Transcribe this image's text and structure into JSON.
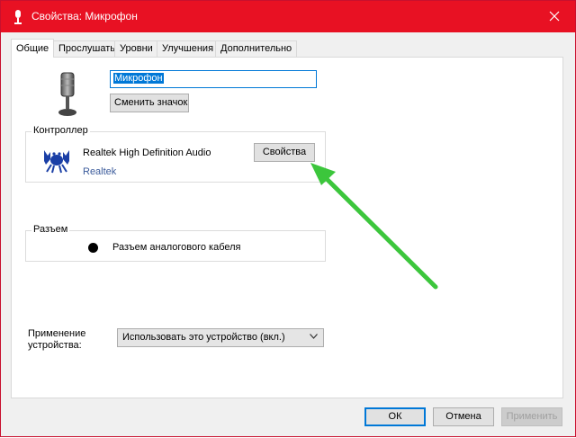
{
  "window": {
    "title": "Свойства: Микрофон",
    "colors": {
      "titlebar": "#e81123",
      "accent": "#0078d7",
      "arrow": "#3cc63c"
    }
  },
  "tabs": [
    {
      "label": "Общие",
      "active": true
    },
    {
      "label": "Прослушать",
      "active": false
    },
    {
      "label": "Уровни",
      "active": false
    },
    {
      "label": "Улучшения",
      "active": false
    },
    {
      "label": "Дополнительно",
      "active": false
    }
  ],
  "device": {
    "icon": "microphone-icon",
    "name_value": "Микрофон",
    "change_icon_label": "Сменить значок"
  },
  "controller": {
    "group_label": "Контроллер",
    "driver_name": "Realtek High Definition Audio",
    "vendor": "Realtek",
    "logo": "realtek-crab-icon",
    "properties_label": "Свойства"
  },
  "jack": {
    "group_label": "Разъем",
    "label": "Разъем аналогового кабеля"
  },
  "usage": {
    "label_line1": "Применение",
    "label_line2": "устройства:",
    "selected": "Использовать это устройство (вкл.)"
  },
  "footer": {
    "ok_label": "ОК",
    "cancel_label": "Отмена",
    "apply_label": "Применить"
  }
}
